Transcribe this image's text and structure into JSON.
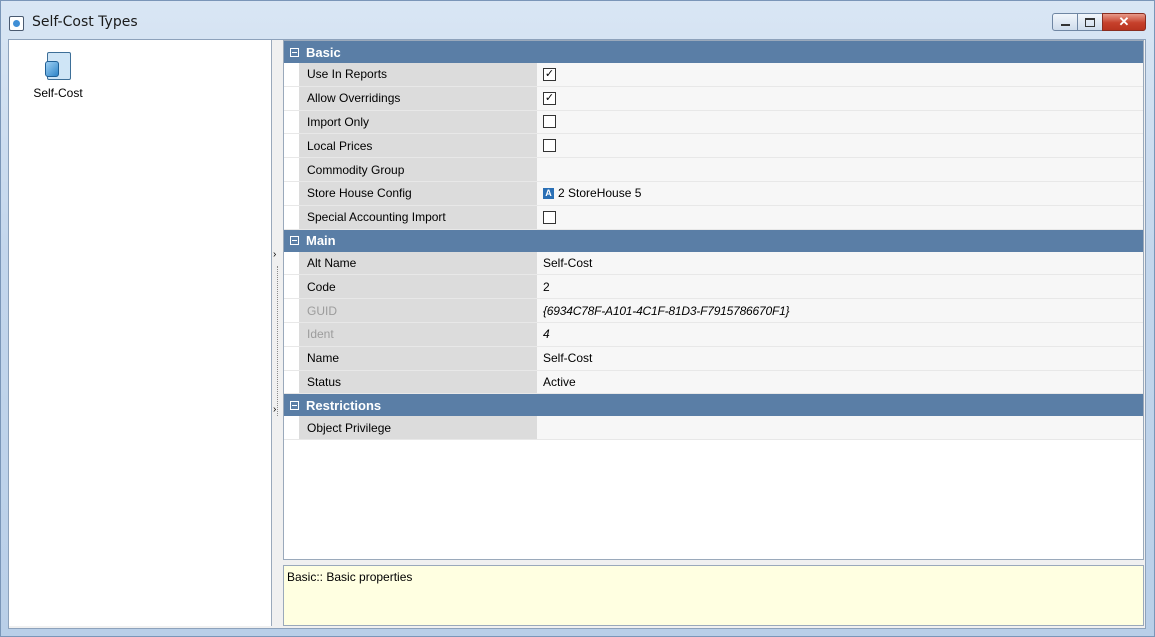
{
  "window": {
    "title": "Self-Cost Types"
  },
  "tree": {
    "items": [
      {
        "label": "Self-Cost",
        "icon": "cube-document-icon"
      }
    ]
  },
  "grid": {
    "categories": [
      {
        "name": "Basic",
        "rows": [
          {
            "name": "Use In Reports",
            "type": "checkbox",
            "checked": true
          },
          {
            "name": "Allow Overridings",
            "type": "checkbox",
            "checked": true
          },
          {
            "name": "Import Only",
            "type": "checkbox",
            "checked": false
          },
          {
            "name": "Local Prices",
            "type": "checkbox",
            "checked": false
          },
          {
            "name": "Commodity Group",
            "type": "text",
            "value": ""
          },
          {
            "name": "Store House Config",
            "type": "ref",
            "value": "2 StoreHouse 5",
            "icon_letter": "A"
          },
          {
            "name": "Special Accounting Import",
            "type": "checkbox",
            "checked": false
          }
        ]
      },
      {
        "name": "Main",
        "rows": [
          {
            "name": "Alt Name",
            "type": "text",
            "value": "Self-Cost"
          },
          {
            "name": "Code",
            "type": "text",
            "value": "2"
          },
          {
            "name": "GUID",
            "type": "text",
            "value": "{6934C78F-A101-4C1F-81D3-F7915786670F1}",
            "readonly": true
          },
          {
            "name": "Ident",
            "type": "text",
            "value": "4",
            "readonly": true
          },
          {
            "name": "Name",
            "type": "text",
            "value": "Self-Cost"
          },
          {
            "name": "Status",
            "type": "text",
            "value": "Active"
          }
        ]
      },
      {
        "name": "Restrictions",
        "rows": [
          {
            "name": "Object Privilege",
            "type": "text",
            "value": ""
          }
        ]
      }
    ]
  },
  "description": {
    "text": "Basic:: Basic properties"
  },
  "colors": {
    "category_bar": "#5a7ea6",
    "description_bg": "#ffffe1",
    "close_button": "#c6402b"
  }
}
